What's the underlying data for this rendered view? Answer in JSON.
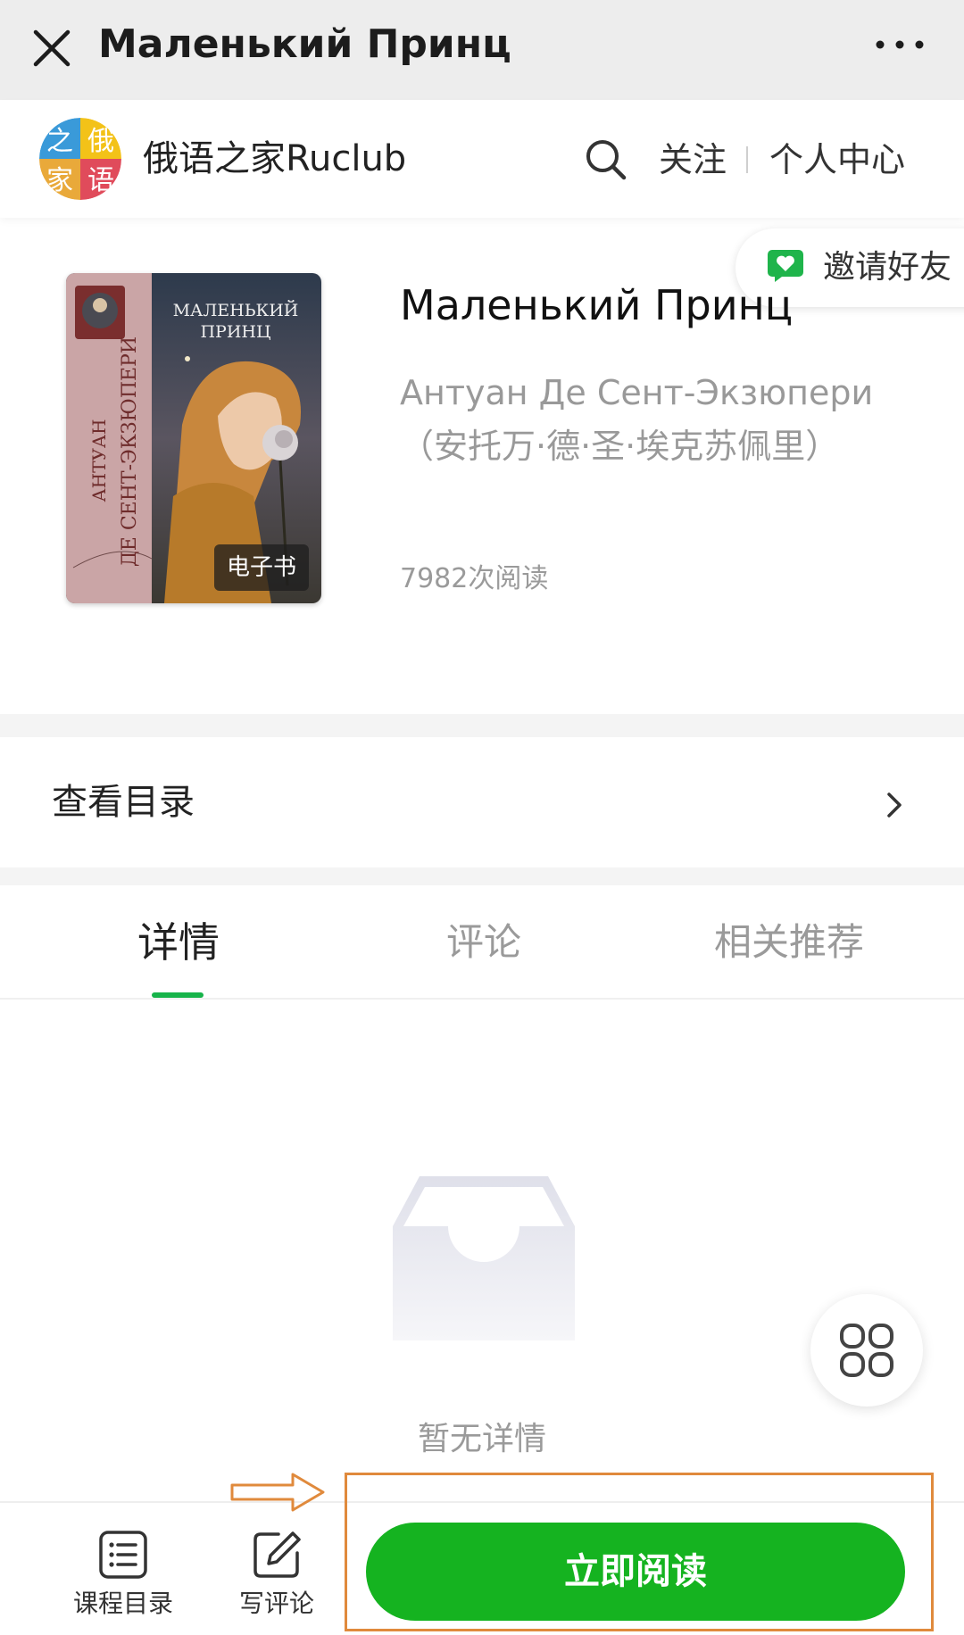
{
  "navbar": {
    "title": "Маленький Принц"
  },
  "shop": {
    "logo_chars": [
      "之",
      "俄",
      "家",
      "语"
    ],
    "name": "俄语之家Ruclub",
    "follow_label": "关注",
    "center_label": "个人中心"
  },
  "invite": {
    "label": "邀请好友"
  },
  "book": {
    "cover_title_lines": [
      "МАЛЕНЬКИЙ",
      "ПРИНЦ"
    ],
    "cover_author_lines": [
      "АНТУАН",
      "ДЕ СЕНТ-ЭКЗЮПЕРИ"
    ],
    "cover_badge": "电子书",
    "title": "Маленький Принц",
    "author": "Антуан Де Сент-Экзюпери（安托万·德·圣·埃克苏佩里）",
    "reads": "7982次阅读"
  },
  "toc": {
    "label": "查看目录"
  },
  "tabs": [
    {
      "label": "详情",
      "active": true
    },
    {
      "label": "评论",
      "active": false
    },
    {
      "label": "相关推荐",
      "active": false
    }
  ],
  "empty": {
    "text": "暂无详情"
  },
  "bottombar": {
    "course_toc_label": "课程目录",
    "write_review_label": "写评论",
    "read_now_label": "立即阅读"
  },
  "colors": {
    "accent_green": "#15b320",
    "tab_indicator": "#17b34a",
    "annotation_orange": "#e08a3c"
  },
  "icons": [
    "close-icon",
    "more-icon",
    "search-icon",
    "heart-chat-icon",
    "chevron-right-icon",
    "empty-box-icon",
    "grid-menu-icon",
    "list-icon",
    "edit-icon",
    "arrow-right-icon"
  ]
}
